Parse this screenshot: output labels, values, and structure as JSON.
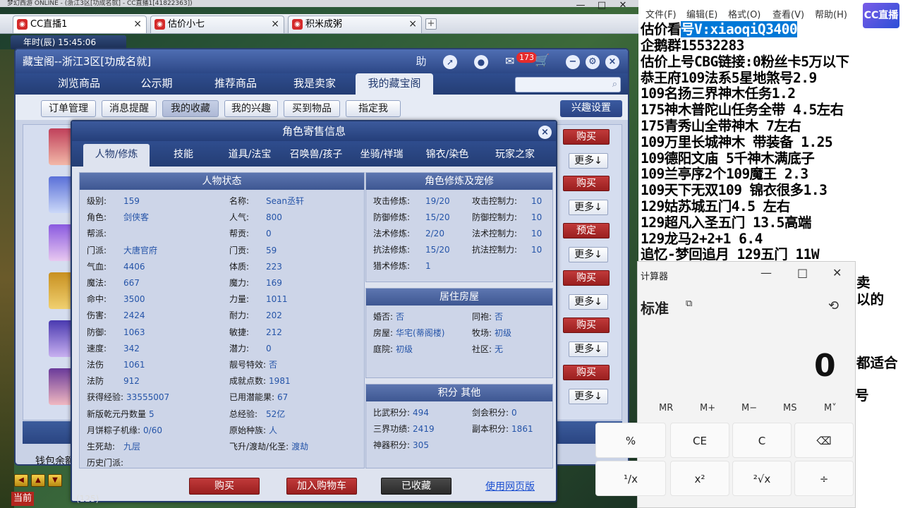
{
  "game": {
    "topbar": "梦幻西游 ONLINE - (浙江3区[功成名就] - CC直播1[41822363])",
    "time": "年时(辰)   15:45:06"
  },
  "browser": {
    "tabs": [
      {
        "label": "CC直播1"
      },
      {
        "label": "估价小七"
      },
      {
        "label": "积米成粥"
      }
    ],
    "new_tab": "+",
    "win_min": "—",
    "win_max": "□",
    "win_close": "✕"
  },
  "cbg": {
    "title": "藏宝阁--浙江3区[功成名就]",
    "help": "助",
    "msg_count": "173",
    "nav": [
      "浏览商品",
      "公示期",
      "推荐商品",
      "我是卖家",
      "我的藏宝阁"
    ],
    "subnav": [
      "订单管理",
      "消息提醒",
      "我的收藏",
      "我的兴趣",
      "买到物品",
      "指定我"
    ],
    "interest_settings": "兴趣设置",
    "buy_label": "购买",
    "reserve_label": "预定",
    "more_label": "更多↓",
    "wallet": "钱包余额"
  },
  "dialog": {
    "title": "角色寄售信息",
    "tabs": [
      "人物/修炼",
      "技能",
      "道具/法宝",
      "召唤兽/孩子",
      "坐骑/祥瑞",
      "锦衣/染色",
      "玩家之家"
    ],
    "status_header": "人物状态",
    "status_left": [
      {
        "k": "级别:",
        "v": "159"
      },
      {
        "k": "角色:",
        "v": "剑侠客"
      },
      {
        "k": "帮派:",
        "v": ""
      },
      {
        "k": "门派:",
        "v": "大唐官府"
      },
      {
        "k": "气血:",
        "v": "4406"
      },
      {
        "k": "魔法:",
        "v": "667"
      },
      {
        "k": "命中:",
        "v": "3500"
      },
      {
        "k": "伤害:",
        "v": "2424"
      },
      {
        "k": "防御:",
        "v": "1063"
      },
      {
        "k": "速度:",
        "v": "342"
      },
      {
        "k": "法伤",
        "v": "1061"
      },
      {
        "k": "法防",
        "v": "912"
      },
      {
        "k": "获得经验:",
        "v": "33555007"
      },
      {
        "k": "新版乾元丹数量",
        "v": "5"
      },
      {
        "k": "月饼粽子机缘:",
        "v": "0/60"
      },
      {
        "k": "生死劫:",
        "v": "九层"
      },
      {
        "k": "历史门派:",
        "v": ""
      }
    ],
    "status_right": [
      {
        "k": "名称:",
        "v": "Sean丞轩"
      },
      {
        "k": "人气:",
        "v": "800"
      },
      {
        "k": "帮贡:",
        "v": "0"
      },
      {
        "k": "门贡:",
        "v": "59"
      },
      {
        "k": "体质:",
        "v": "223"
      },
      {
        "k": "魔力:",
        "v": "169"
      },
      {
        "k": "力量:",
        "v": "1011"
      },
      {
        "k": "耐力:",
        "v": "202"
      },
      {
        "k": "敏捷:",
        "v": "212"
      },
      {
        "k": "潜力:",
        "v": "0"
      },
      {
        "k": "靓号特效:",
        "v": "否"
      },
      {
        "k": "成就点数:",
        "v": "1981"
      },
      {
        "k": "已用潜能果:",
        "v": "67"
      },
      {
        "k": "总经验:",
        "v": "52亿"
      },
      {
        "k": "原始种族:",
        "v": "人"
      },
      {
        "k": "飞升/渡劫/化圣:",
        "v": "渡劫"
      }
    ],
    "cultivation_header": "角色修炼及宠修",
    "cultivation_left": [
      {
        "k": "攻击修炼:",
        "v": "19/20"
      },
      {
        "k": "防御修炼:",
        "v": "15/20"
      },
      {
        "k": "法术修炼:",
        "v": "2/20"
      },
      {
        "k": "抗法修炼:",
        "v": "15/20"
      },
      {
        "k": "猎术修炼:",
        "v": "1"
      }
    ],
    "cultivation_right": [
      {
        "k": "攻击控制力:",
        "v": "10"
      },
      {
        "k": "防御控制力:",
        "v": "10"
      },
      {
        "k": "法术控制力:",
        "v": "10"
      },
      {
        "k": "抗法控制力:",
        "v": "10"
      }
    ],
    "house_header": "居住房屋",
    "house": [
      {
        "k": "婚否:",
        "v": "否"
      },
      {
        "k": "同袍:",
        "v": "否"
      },
      {
        "k": "房屋:",
        "v": "华宅(蒂阁楼)"
      },
      {
        "k": "牧场:",
        "v": "初级"
      },
      {
        "k": "庭院:",
        "v": "初级"
      },
      {
        "k": "社区:",
        "v": "无"
      }
    ],
    "points_header": "积分 其他",
    "points": [
      {
        "k": "比武积分:",
        "v": "494"
      },
      {
        "k": "剑会积分:",
        "v": "0"
      },
      {
        "k": "三界功绩:",
        "v": "2419"
      },
      {
        "k": "副本积分:",
        "v": "1861"
      },
      {
        "k": "神器积分:",
        "v": "305"
      }
    ],
    "btn_buy": "购买",
    "btn_cart": "加入购物车",
    "btn_fav": "已收藏",
    "btn_web": "使用网页版"
  },
  "bottom": {
    "current": "当前",
    "level": "(125)"
  },
  "notepad": {
    "menu": [
      "文件(F)",
      "编辑(E)",
      "格式(O)",
      "查看(V)",
      "帮助(H)"
    ],
    "logo": "CC直播",
    "line1_pre": "估价看",
    "line1_sel": "号V:xiaoqiQ3400",
    "lines": [
      "企鹅群15532283",
      "估价上号CBG链接:0粉丝卡5万以下",
      "恭王府109法系5星地煞号2.9",
      "109名扬三界神木任务1.2",
      "175神木普陀山任务全带 4.5左右",
      "175青秀山全带神木  7左右",
      "109万里长城神木 带装备  1.25",
      "109德阳文庙 5千神木满底子",
      "109兰亭序2个109魔王 2.3",
      "109天下无双109  锦衣很多1.3",
      "129姑苏城五门4.5 左右",
      "129超凡入圣五门  13.5高端",
      "129龙马2+2+1  6.4",
      "追忆-梦回追月 129五门 11W"
    ],
    "overflow": [
      "卖",
      "以的",
      "都适合",
      "号"
    ]
  },
  "calculator": {
    "title": "计算器",
    "min": "—",
    "max": "□",
    "close": "✕",
    "mode": "标准",
    "display": "0",
    "memory": [
      "MR",
      "M+",
      "M−",
      "MS",
      "M˅"
    ],
    "keys_row1": [
      "%",
      "CE",
      "C",
      "⌫"
    ],
    "keys_row2": [
      "¹/x",
      "x²",
      "²√x",
      "÷"
    ]
  },
  "colors": {
    "accent_blue": "#2c4786",
    "buy_red": "#9a1f1f",
    "selection": "#0078d7"
  }
}
